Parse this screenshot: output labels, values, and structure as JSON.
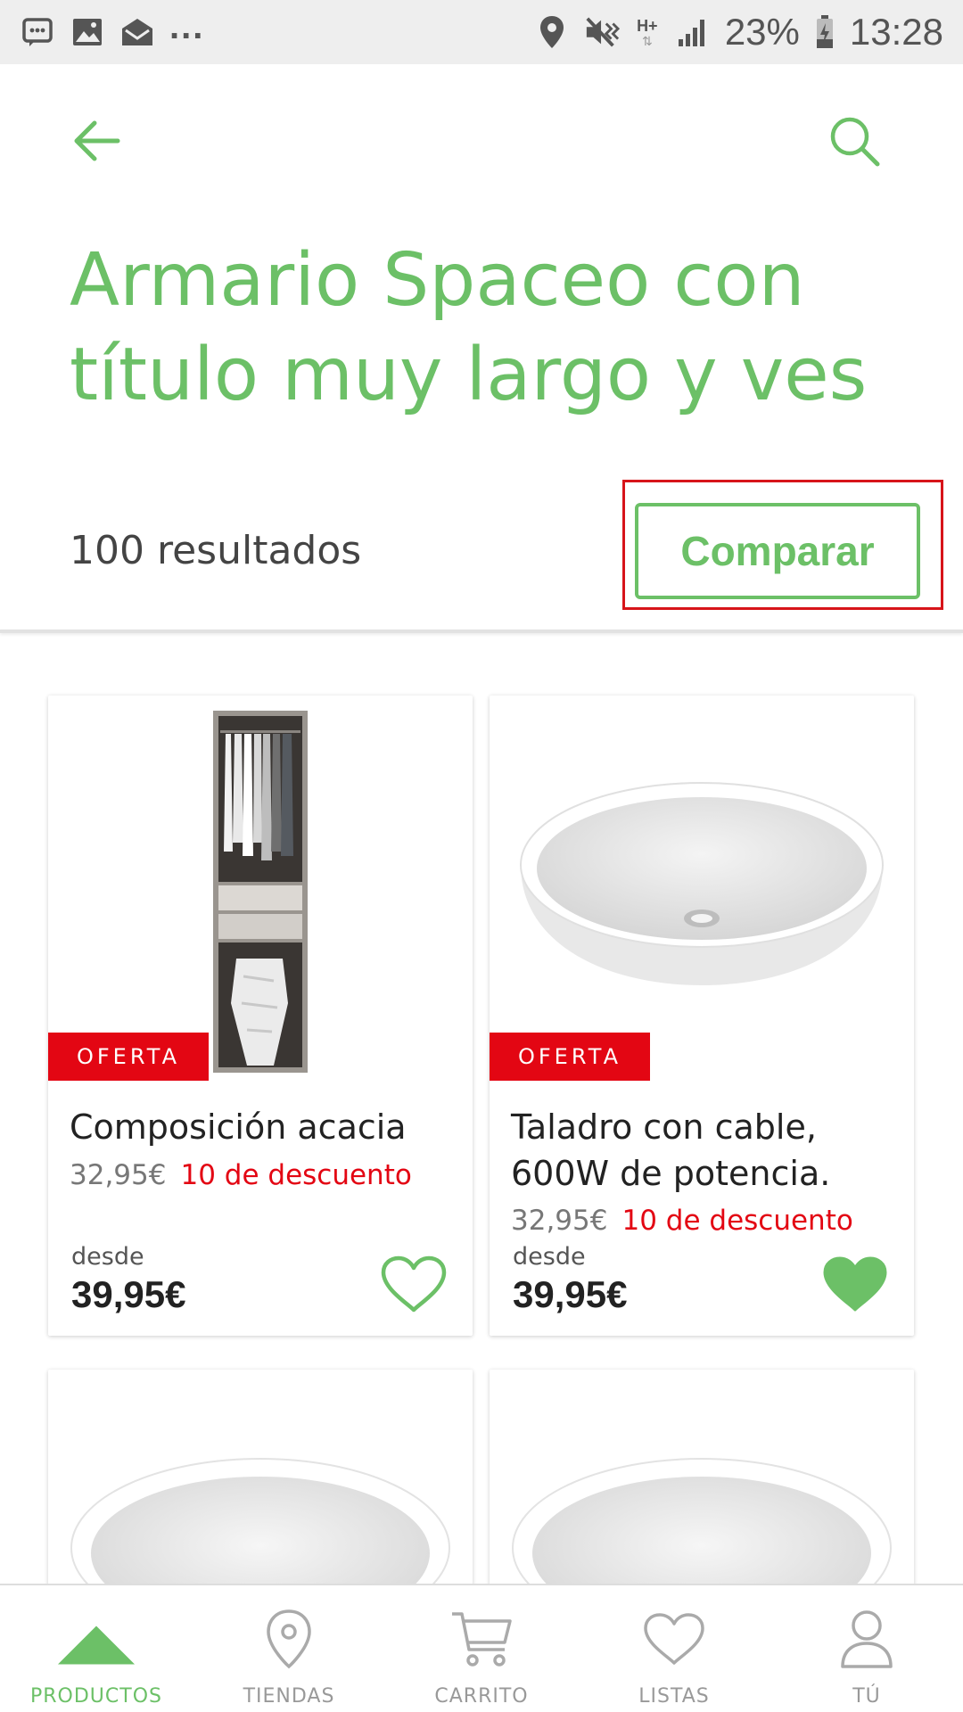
{
  "status_bar": {
    "battery": "23%",
    "time": "13:28",
    "network": "H+",
    "overflow": "...",
    "icons": [
      "message-notification-icon",
      "image-notification-icon",
      "mail-notification-icon",
      "location-icon",
      "vibrate-icon",
      "signal-icon",
      "battery-icon"
    ]
  },
  "header": {
    "back_icon": "arrow-left-icon",
    "search_icon": "search-icon",
    "title": "Armario Spaceo con título muy largo y ves",
    "results": "100 resultados",
    "compare_label": "Comparar"
  },
  "colors": {
    "accent": "#6cc067",
    "offer": "#e30613",
    "highlight": "#d7141a"
  },
  "products": [
    {
      "badge": "OFERTA",
      "title": "Composición acacia",
      "old_price": "32,95€",
      "discount": "10 de descuento",
      "from_label": "desde",
      "price": "39,95€",
      "favorite": false,
      "image": "wardrobe"
    },
    {
      "badge": "OFERTA",
      "title": "Taladro con cable, 600W de potencia.",
      "old_price": "32,95€",
      "discount": "10 de descuento",
      "from_label": "desde",
      "price": "39,95€",
      "favorite": true,
      "image": "washbasin"
    },
    {
      "image": "washbasin"
    },
    {
      "image": "washbasin"
    }
  ],
  "bottom_nav": [
    {
      "label": "PRODUCTOS",
      "icon": "products-triangle-icon",
      "active": true
    },
    {
      "label": "TIENDAS",
      "icon": "store-location-icon",
      "active": false
    },
    {
      "label": "CARRITO",
      "icon": "cart-icon",
      "active": false
    },
    {
      "label": "LISTAS",
      "icon": "heart-icon",
      "active": false
    },
    {
      "label": "TÚ",
      "icon": "user-icon",
      "active": false
    }
  ]
}
